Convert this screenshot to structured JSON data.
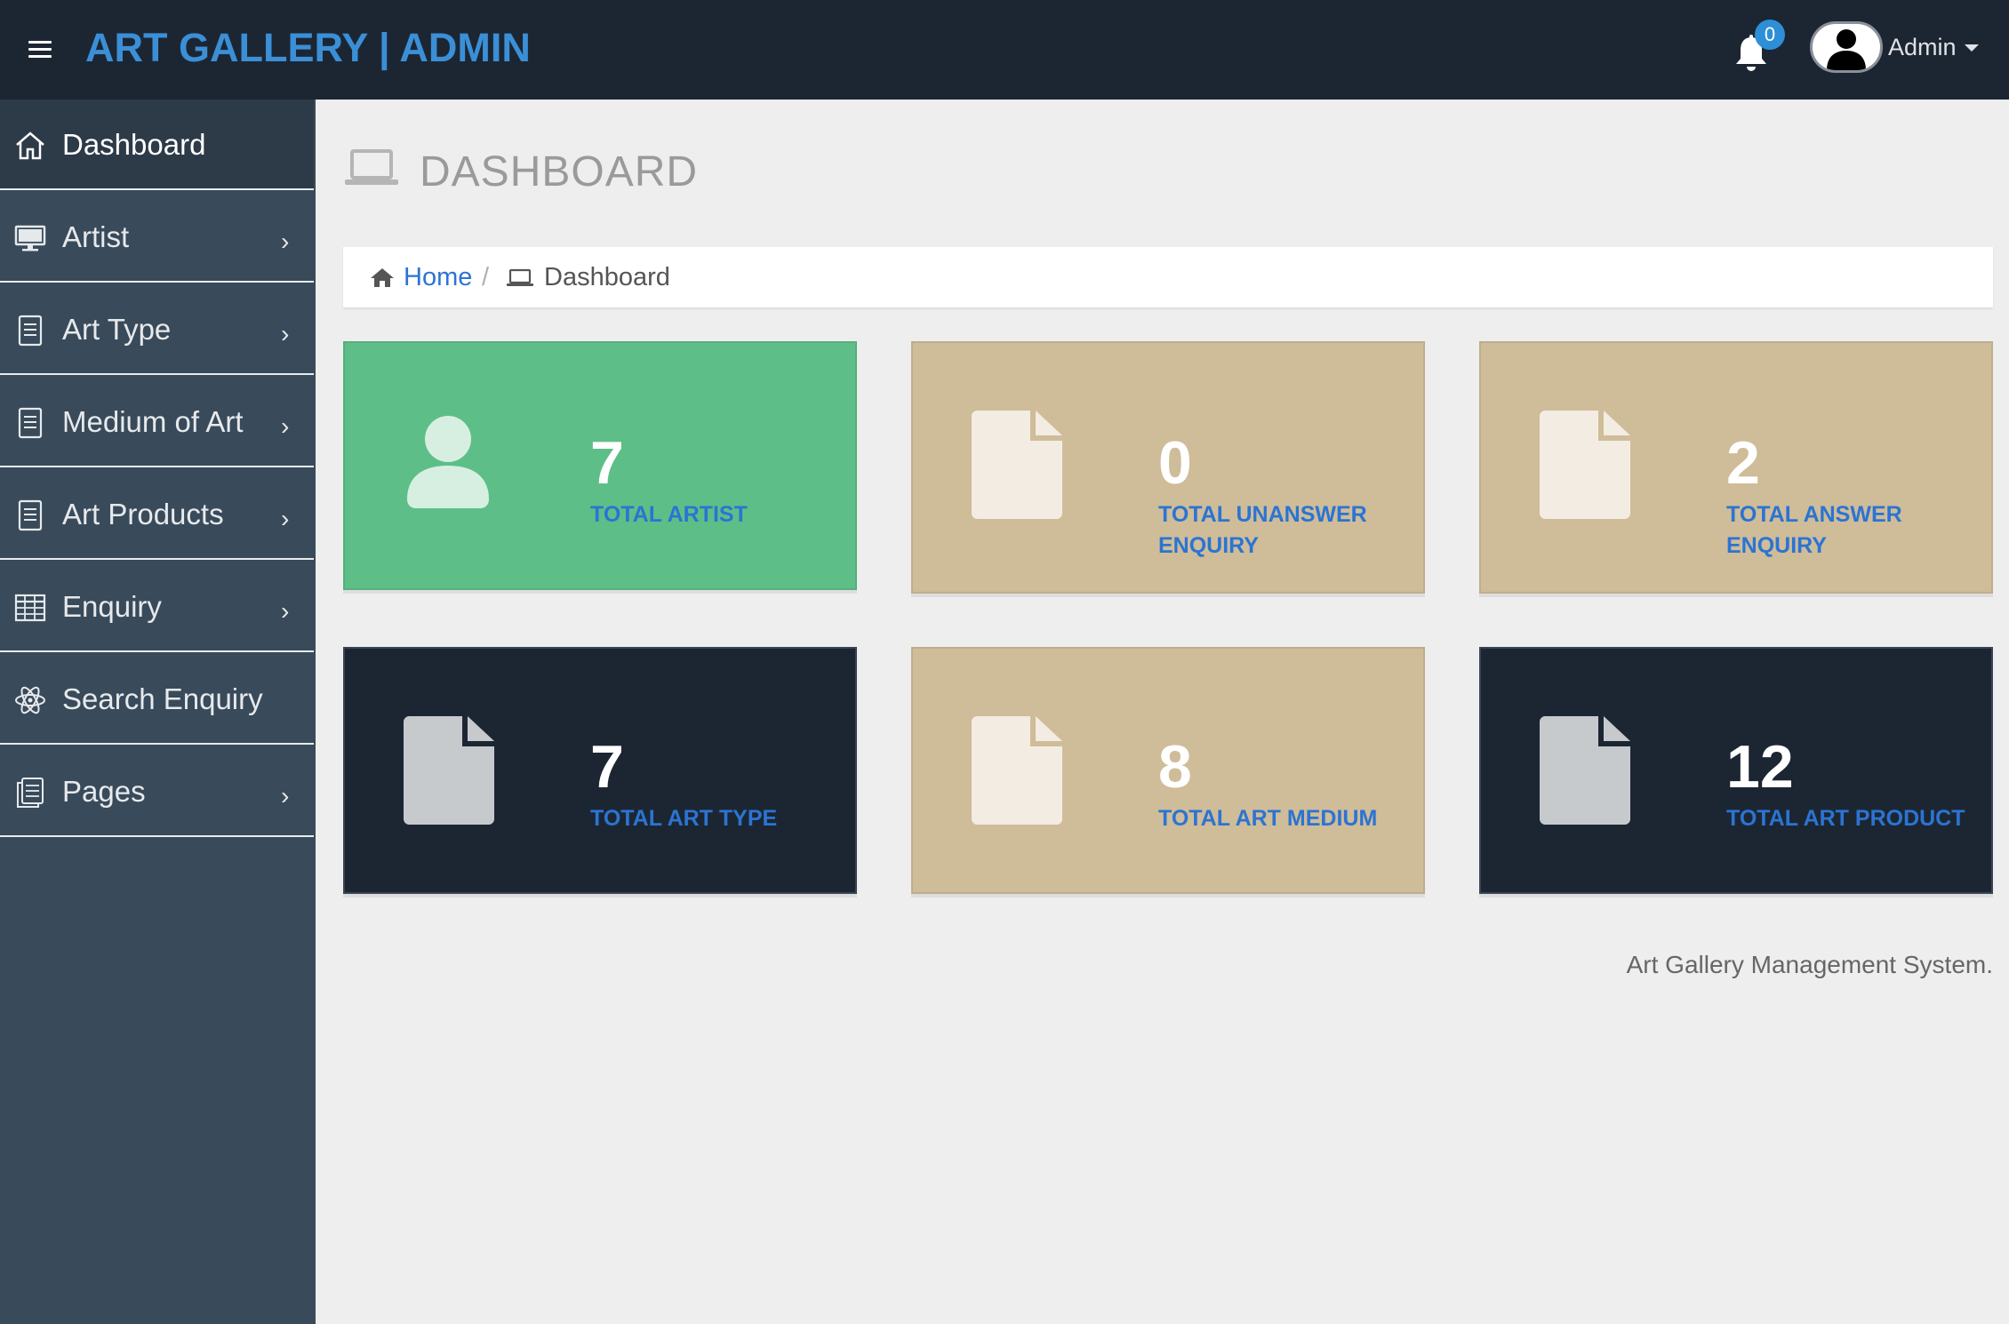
{
  "header": {
    "brand": "ART GALLERY | ADMIN",
    "notification_count": "0",
    "user_name": "Admin"
  },
  "sidebar": {
    "items": [
      {
        "label": "Dashboard",
        "icon": "home-icon",
        "has_submenu": false
      },
      {
        "label": "Artist",
        "icon": "monitor-icon",
        "has_submenu": true
      },
      {
        "label": "Art Type",
        "icon": "document-icon",
        "has_submenu": true
      },
      {
        "label": "Medium of Art",
        "icon": "document-icon",
        "has_submenu": true
      },
      {
        "label": "Art Products",
        "icon": "document-icon",
        "has_submenu": true
      },
      {
        "label": "Enquiry",
        "icon": "table-icon",
        "has_submenu": true
      },
      {
        "label": "Search Enquiry",
        "icon": "atom-icon",
        "has_submenu": false
      },
      {
        "label": "Pages",
        "icon": "pages-icon",
        "has_submenu": true
      }
    ],
    "chevron": "›"
  },
  "main": {
    "title": "DASHBOARD",
    "breadcrumb": {
      "home": "Home",
      "separator": "/",
      "current": "Dashboard"
    },
    "cards": [
      {
        "value": "7",
        "label": "TOTAL ARTIST",
        "icon": "user-icon",
        "color": "#5dbf87"
      },
      {
        "value": "0",
        "label": "TOTAL UNANSWER ENQUIRY",
        "icon": "file-icon",
        "color": "#cfbc99"
      },
      {
        "value": "2",
        "label": "TOTAL ANSWER ENQUIRY",
        "icon": "file-icon",
        "color": "#cfbc99"
      },
      {
        "value": "7",
        "label": "TOTAL ART TYPE",
        "icon": "file-icon",
        "color": "#1c2633"
      },
      {
        "value": "8",
        "label": "TOTAL ART MEDIUM",
        "icon": "file-icon",
        "color": "#cfbc99"
      },
      {
        "value": "12",
        "label": "TOTAL ART PRODUCT",
        "icon": "file-icon",
        "color": "#1c2633"
      }
    ],
    "footer": "Art Gallery Management System."
  },
  "colors": {
    "topbar": "#1c2633",
    "sidebar": "#394a5a",
    "brand": "#3b8fd6",
    "link": "#2b74d3",
    "background": "#eeeeee"
  }
}
